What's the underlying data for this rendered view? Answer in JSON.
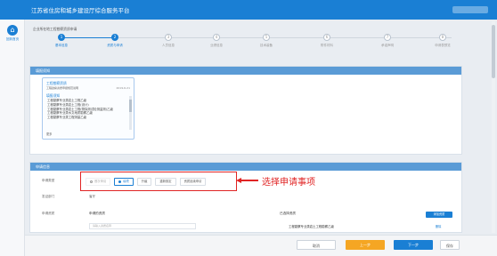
{
  "header": {
    "app_title": "江苏省住房和城乡建设厅综合服务平台"
  },
  "sidebar": {
    "home_label": "回到首页"
  },
  "breadcrumb": "企业所在地工程勘察资质申请",
  "steps": [
    {
      "label": "基本信息",
      "active": true
    },
    {
      "label": "资质与申请",
      "active": true
    },
    {
      "label": "人员信息",
      "active": false
    },
    {
      "label": "业绩信息",
      "active": false
    },
    {
      "label": "技术装备",
      "active": false
    },
    {
      "label": "附件材料",
      "active": false
    },
    {
      "label": "承诺声明",
      "active": false
    },
    {
      "label": "申请表预览",
      "active": false
    }
  ],
  "help_panel": {
    "header": "填报须知",
    "title": "工程勘察资质",
    "info": "工程勘察资质申报规范说明",
    "date": "2019-6-21",
    "sub_title": "填报须知",
    "items": [
      "工程勘察专业类岩土工程乙级",
      "工程勘察专业类岩土工程(设计)",
      "工程勘察专业类岩土工程(物探测试检测监测)乙级",
      "工程勘察专业类水文地质勘察乙级",
      "工程勘察专业类工程测量乙级"
    ],
    "more": "更多"
  },
  "application_panel": {
    "header": "申请信息",
    "label_type": "申请类型",
    "options": [
      {
        "label": "首次申请",
        "state": "disabled"
      },
      {
        "label": "增项",
        "state": "selected"
      },
      {
        "label": "升级",
        "state": "normal"
      },
      {
        "label": "重新核定",
        "state": "normal"
      },
      {
        "label": "资质延续申请",
        "state": "normal"
      }
    ],
    "label_unit": "发证部门",
    "unit_value": "省厅",
    "label_items": "申请资质",
    "col_left_title": "申请的资质",
    "col_right_title": "已选择资质",
    "add_button": "添加资质",
    "input_placeholder": "请输入资质名称",
    "selected_item": "工程勘察专业类岩土工程勘察乙级",
    "remove_link": "删除"
  },
  "annotation": {
    "text": "选择申请事项",
    "color": "#e02424"
  },
  "footer": {
    "cancel": "取消",
    "prev": "上一步",
    "next": "下一步",
    "save": "保存"
  },
  "colors": {
    "primary": "#1a7fd4",
    "warning": "#f5a623",
    "panel_header": "#5a9bd6"
  }
}
